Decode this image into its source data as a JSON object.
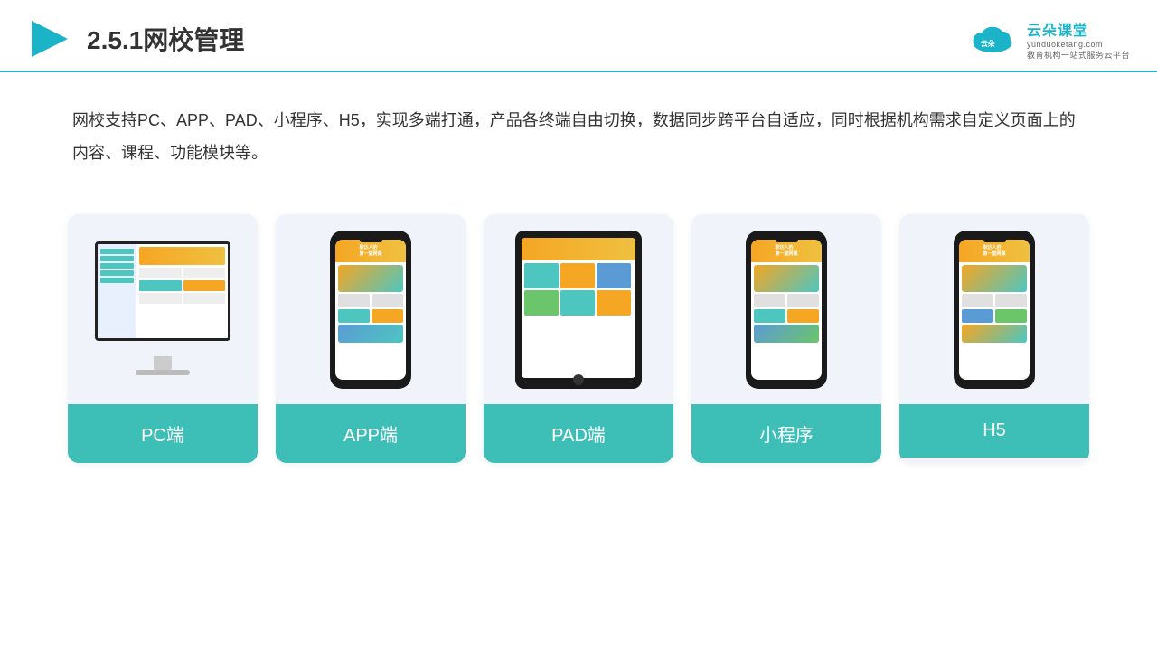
{
  "header": {
    "title": "2.5.1网校管理",
    "logo": {
      "name": "云朵课堂",
      "url": "yunduoketang.com",
      "tagline": "教育机构一站式服务云平台"
    }
  },
  "description": {
    "text": "网校支持PC、APP、PAD、小程序、H5，实现多端打通，产品各终端自由切换，数据同步跨平台自适应，同时根据机构需求自定义页面上的内容、课程、功能模块等。"
  },
  "cards": [
    {
      "id": "pc",
      "label": "PC端",
      "type": "monitor"
    },
    {
      "id": "app",
      "label": "APP端",
      "type": "phone"
    },
    {
      "id": "pad",
      "label": "PAD端",
      "type": "tablet"
    },
    {
      "id": "miniprogram",
      "label": "小程序",
      "type": "phone"
    },
    {
      "id": "h5",
      "label": "H5",
      "type": "phone"
    }
  ],
  "brand": {
    "accent": "#3dbfb8",
    "dark": "#1a1a1a"
  }
}
